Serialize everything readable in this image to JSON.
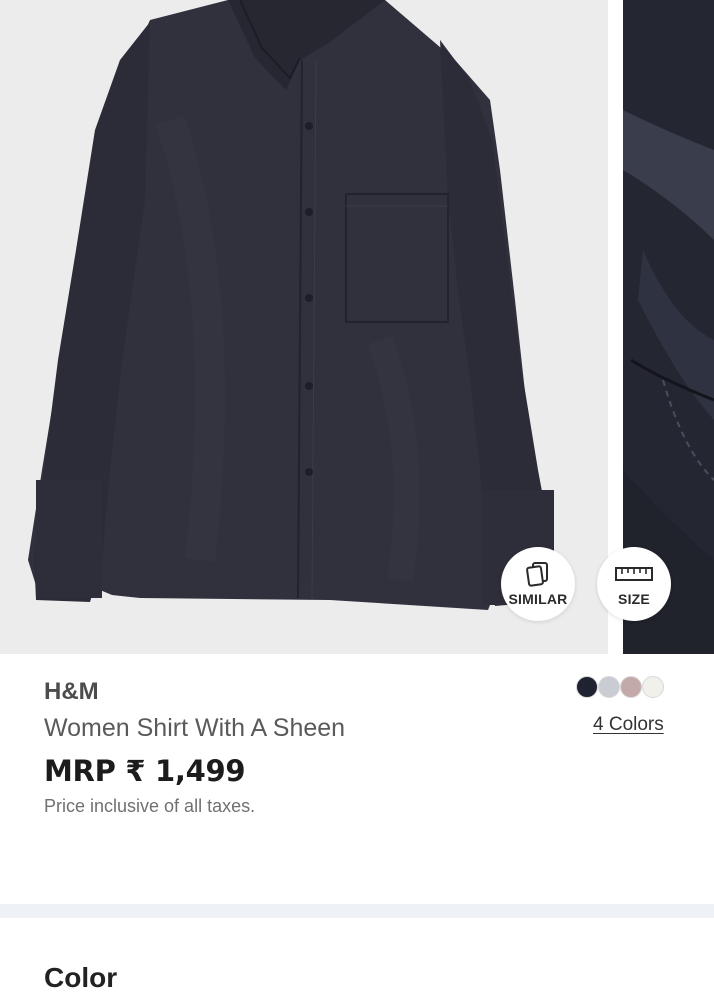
{
  "gallery": {
    "images": [
      {
        "alt": "shirt-front-image"
      },
      {
        "alt": "shirt-detail-image"
      }
    ],
    "similar_button": {
      "label": "SIMILAR",
      "icon": "cards-icon"
    },
    "size_button": {
      "label": "SIZE",
      "icon": "ruler-icon"
    }
  },
  "product": {
    "brand": "H&M",
    "name": "Women Shirt With A Sheen",
    "price": "MRP ₹ 1,499",
    "tax_note": "Price inclusive of all taxes.",
    "colors_link": "4 Colors",
    "swatches": [
      "#1f2230",
      "#c9ccd3",
      "#c3aaa9",
      "#f1f0ea"
    ]
  },
  "sections": {
    "color_heading": "Color"
  }
}
